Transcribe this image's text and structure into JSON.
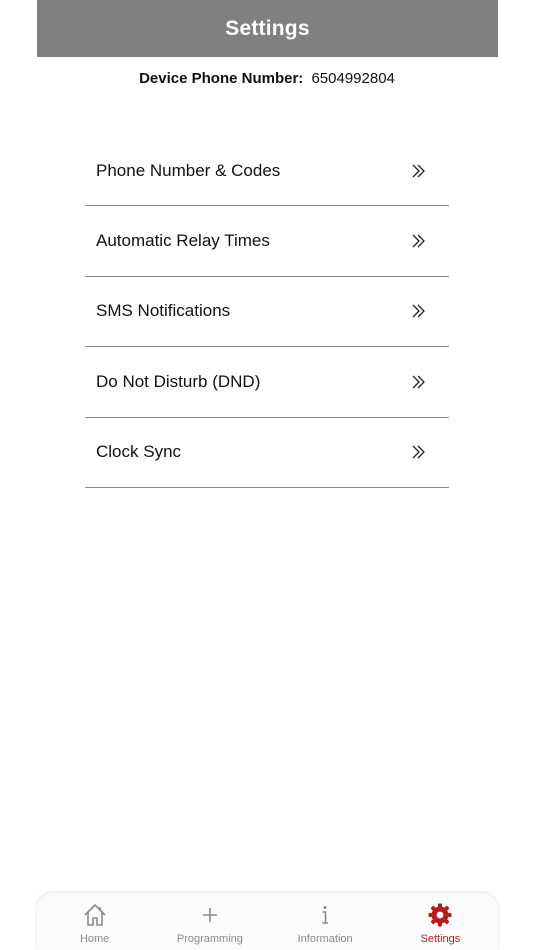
{
  "header": {
    "title": "Settings",
    "background_color": "#808080"
  },
  "device": {
    "label": "Device Phone Number:",
    "phone_number": "6504992804"
  },
  "menu": {
    "items": [
      {
        "label": "Phone Number & Codes",
        "icon": "double-chevron-right-icon"
      },
      {
        "label": "Automatic Relay Times",
        "icon": "double-chevron-right-icon"
      },
      {
        "label": "SMS Notifications",
        "icon": "double-chevron-right-icon"
      },
      {
        "label": "Do Not Disturb (DND)",
        "icon": "double-chevron-right-icon"
      },
      {
        "label": "Clock Sync",
        "icon": "double-chevron-right-icon"
      }
    ]
  },
  "tabbar": {
    "active_color": "#b81b1b",
    "inactive_color": "#8a8a8a",
    "tabs": [
      {
        "label": "Home",
        "icon": "home-icon",
        "active": false
      },
      {
        "label": "Programming",
        "icon": "plus-icon",
        "active": false
      },
      {
        "label": "Information",
        "icon": "info-icon",
        "active": false
      },
      {
        "label": "Settings",
        "icon": "gear-icon",
        "active": true
      }
    ]
  }
}
